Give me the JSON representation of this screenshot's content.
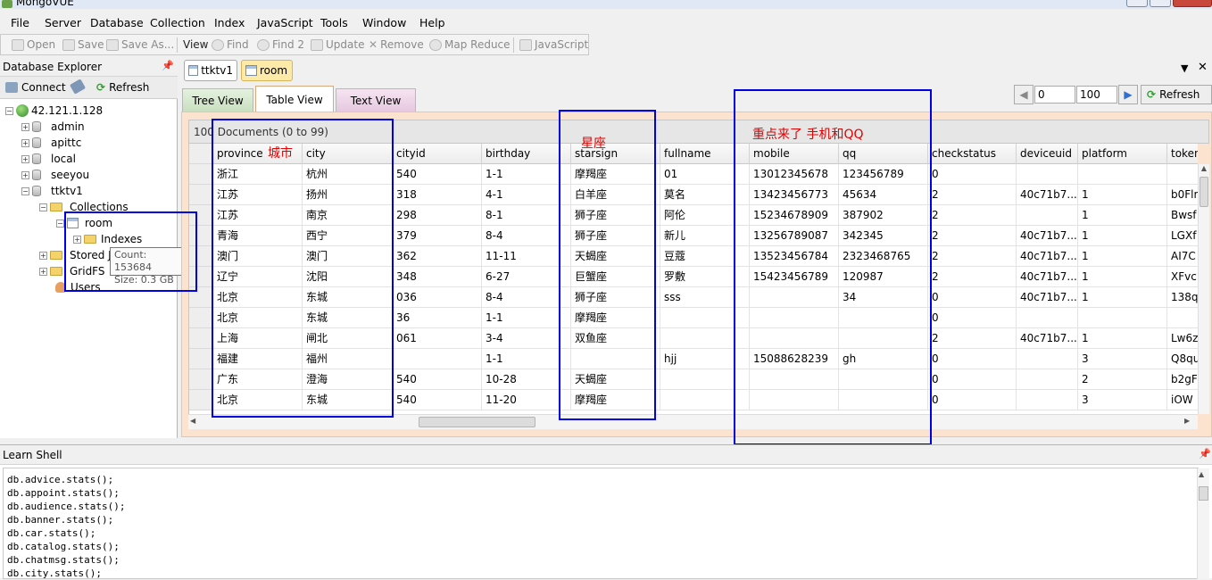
{
  "window": {
    "title": "MongoVUE"
  },
  "menu": [
    "File",
    "Server",
    "Database",
    "Collection",
    "Index",
    "JavaScript",
    "Tools",
    "Window",
    "Help"
  ],
  "toolbar": {
    "open": "Open",
    "save": "Save",
    "save_as": "Save As...",
    "view": "View",
    "find": "Find",
    "find2": "Find 2",
    "update": "Update",
    "remove": "Remove",
    "map_reduce": "Map Reduce",
    "javascript": "JavaScript"
  },
  "explorer": {
    "title": "Database Explorer",
    "pin": "҉",
    "connect": "Connect",
    "refresh": "Refresh",
    "server": "42.121.1.128",
    "databases": [
      "admin",
      "apittc",
      "local",
      "seeyou",
      "ttktv1"
    ],
    "collections_label": "Collections",
    "collection": "room",
    "indexes": "Indexes",
    "stored": "Stored J",
    "gridfs": "GridFS",
    "users": "Users",
    "tooltip": {
      "count": "Count: 153684",
      "size": "Size: 0.3 GB"
    }
  },
  "tabs": {
    "doc_tabs": [
      "ttktv1",
      "room"
    ],
    "views": [
      "Tree View",
      "Table View",
      "Text View"
    ],
    "active_view": "Table View"
  },
  "pager": {
    "start": "0",
    "limit": "100",
    "refresh": "Refresh"
  },
  "docbar": "100 Documents (0 to 99)",
  "annotations": {
    "city": "城市",
    "star": "星座",
    "contact": "重点来了 手机和QQ"
  },
  "table": {
    "columns": [
      "province",
      "city",
      "cityid",
      "birthday",
      "starsign",
      "fullname",
      "mobile",
      "qq",
      "checkstatus",
      "deviceuid",
      "platform",
      "token"
    ],
    "rows": [
      [
        "浙江",
        "杭州",
        "540",
        "1-1",
        "摩羯座",
        "01",
        "13012345678",
        "123456789",
        "0",
        "",
        "",
        ""
      ],
      [
        "江苏",
        "扬州",
        "318",
        "4-1",
        "白羊座",
        "莫名",
        "13423456773",
        "45634",
        "2",
        "40c71b7...",
        "1",
        "b0Flr"
      ],
      [
        "江苏",
        "南京",
        "298",
        "8-1",
        "狮子座",
        "阿伦",
        "15234678909",
        "387902",
        "2",
        "",
        "1",
        "Bwsf"
      ],
      [
        "青海",
        "西宁",
        "379",
        "8-4",
        "狮子座",
        "新儿",
        "13256789087",
        "342345",
        "2",
        "40c71b7...",
        "1",
        "LGXf"
      ],
      [
        "澳门",
        "澳门",
        "362",
        "11-11",
        "天蝎座",
        "豆蔻",
        "13523456784",
        "2323468765",
        "2",
        "40c71b7...",
        "1",
        "AI7C"
      ],
      [
        "辽宁",
        "沈阳",
        "348",
        "6-27",
        "巨蟹座",
        "罗敷",
        "15423456789",
        "120987",
        "2",
        "40c71b7...",
        "1",
        "XFvc"
      ],
      [
        "北京",
        "东城",
        "036",
        "8-4",
        "狮子座",
        "sss",
        "",
        "34",
        "0",
        "40c71b7...",
        "1",
        "138q"
      ],
      [
        "北京",
        "东城",
        "36",
        "1-1",
        "摩羯座",
        "",
        "",
        "",
        "0",
        "",
        "",
        ""
      ],
      [
        "上海",
        "闸北",
        "061",
        "3-4",
        "双鱼座",
        "",
        "",
        "",
        "2",
        "40c71b7...",
        "1",
        "Lw6z"
      ],
      [
        "福建",
        "福州",
        "",
        "1-1",
        "",
        "hjj",
        "15088628239",
        "gh",
        "0",
        "",
        "3",
        "Q8qu"
      ],
      [
        "广东",
        "澄海",
        "540",
        "10-28",
        "天蝎座",
        "",
        "",
        "",
        "0",
        "",
        "2",
        "b2gF"
      ],
      [
        "北京",
        "东城",
        "540",
        "11-20",
        "摩羯座",
        "",
        "",
        "",
        "0",
        "",
        "3",
        "iOW"
      ]
    ]
  },
  "shell": {
    "title": "Learn Shell",
    "lines": [
      "db.advice.stats();",
      "db.appoint.stats();",
      "db.audience.stats();",
      "db.banner.stats();",
      "db.car.stats();",
      "db.catalog.stats();",
      "db.chatmsg.stats();",
      "db.city.stats();"
    ]
  }
}
